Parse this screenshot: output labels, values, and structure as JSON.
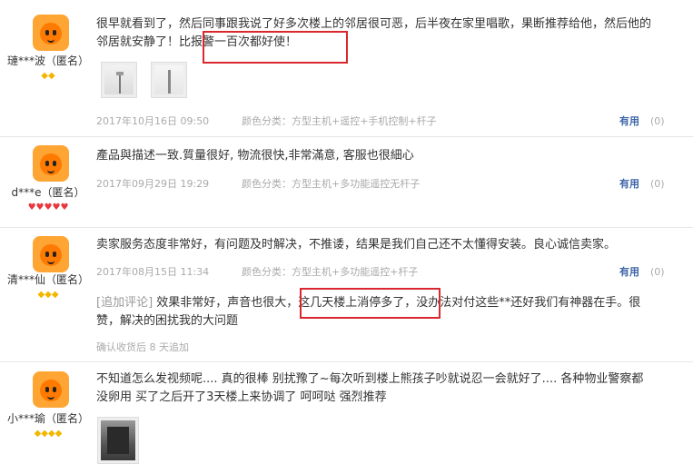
{
  "reviews": [
    {
      "user": "璉***波（匿名）",
      "rank": "◆◆",
      "text": "很早就看到了，然后同事跟我说了好多次楼上的邻居很可恶，后半夜在家里唱歌，果断推荐给他，然后他的邻居就安静了！比报警一百次都好使！",
      "date": "2017年10月16日 09:50",
      "sku": "颜色分类：方型主机+遥控+手机控制+杆子",
      "useful": "有用",
      "useful_count": "(0)"
    },
    {
      "user": "d***e（匿名）",
      "rank": "♥♥♥♥♥",
      "text": "產品與描述一致.質量很好, 物流很快,非常滿意, 客服也很細心",
      "date": "2017年09月29日 19:29",
      "sku": "颜色分类：方型主机+多功能遥控无杆子",
      "useful": "有用",
      "useful_count": "(0)"
    },
    {
      "user": "清***仙（匿名）",
      "rank": "◆◆◆",
      "text": "卖家服务态度非常好，有问题及时解决，不推诿，结果是我们自己还不太懂得安装。良心诚信卖家。",
      "date": "2017年08月15日 11:34",
      "sku": "颜色分类：方型主机+多功能遥控+杆子",
      "useful": "有用",
      "useful_count": "(0)",
      "append_label": "[追加评论]",
      "append_text": "效果非常好，声音也很大，这几天楼上消停多了，没办法对付这些**还好我们有神器在手。很赞，解决的困扰我的大问题",
      "append_time": "确认收货后 8 天追加"
    },
    {
      "user": "小***瑜（匿名）",
      "rank": "◆◆◆◆",
      "text": "不知道怎么发视频呢.... 真的很棒 别扰豫了~每次听到楼上熊孩子吵就说忍一会就好了.... 各种物业警察都没卵用 买了之后开了3天楼上来协调了 呵呵哒 强烈推荐"
    }
  ]
}
